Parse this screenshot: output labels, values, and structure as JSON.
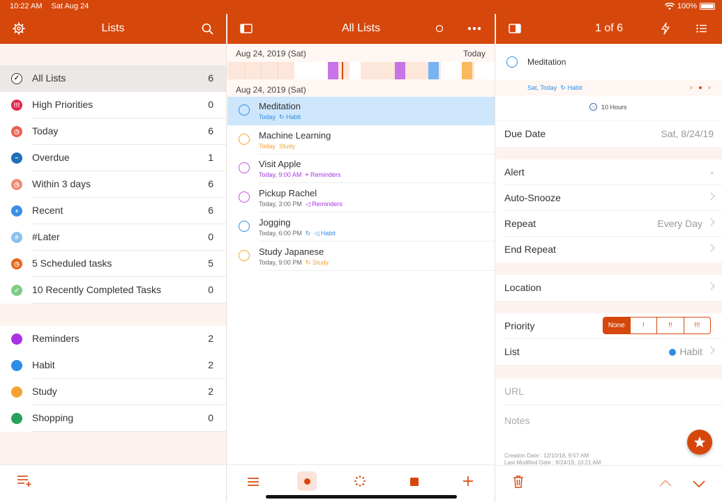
{
  "status": {
    "time": "10:22 AM",
    "date": "Sat Aug 24",
    "battery": "100%"
  },
  "colors": {
    "accent": "#d6470c",
    "habit": "#2d8ee6",
    "study": "#f4a332",
    "reminders": "#a933e0",
    "shopping": "#27a05d"
  },
  "left": {
    "title": "Lists",
    "smart_lists": [
      {
        "label": "All Lists",
        "count": "6",
        "icon": "check-circle-icon"
      },
      {
        "label": "High Priorities",
        "count": "0",
        "icon": "priority-icon"
      },
      {
        "label": "Today",
        "count": "6",
        "icon": "clock-icon"
      },
      {
        "label": "Overdue",
        "count": "1",
        "icon": "overdue-icon"
      },
      {
        "label": "Within 3 days",
        "count": "6",
        "icon": "clock-icon"
      },
      {
        "label": "Recent",
        "count": "6",
        "icon": "plus-icon"
      },
      {
        "label": "#Later",
        "count": "0",
        "icon": "hash-icon"
      },
      {
        "label": "5 Scheduled tasks",
        "count": "5",
        "icon": "clock-icon"
      },
      {
        "label": "10 Recently Completed Tasks",
        "count": "0",
        "icon": "check-icon"
      }
    ],
    "user_lists": [
      {
        "label": "Reminders",
        "count": "2"
      },
      {
        "label": "Habit",
        "count": "2"
      },
      {
        "label": "Study",
        "count": "2"
      },
      {
        "label": "Shopping",
        "count": "0"
      }
    ]
  },
  "middle": {
    "title": "All Lists",
    "timeline_date": "Aug 24, 2019 (Sat)",
    "timeline_today": "Today",
    "section_date": "Aug 24, 2019 (Sat)",
    "tasks": [
      {
        "title": "Meditation",
        "when": "Today",
        "list": "Habit"
      },
      {
        "title": "Machine Learning",
        "when": "Today",
        "list": "Study"
      },
      {
        "title": "Visit Apple",
        "when": "Today, 9:00 AM",
        "list": "Reminders"
      },
      {
        "title": "Pickup Rachel",
        "when": "Today, 3:00 PM",
        "list": "Reminders"
      },
      {
        "title": "Jogging",
        "when": "Today, 6:00 PM",
        "list": "Habit"
      },
      {
        "title": "Study Japanese",
        "when": "Today, 9:00 PM",
        "list": "Study"
      }
    ]
  },
  "right": {
    "title": "1 of 6",
    "task_title": "Meditation",
    "task_when": "Sat, Today",
    "task_list": "Habit",
    "duration": "10 Hours",
    "due_label": "Due Date",
    "due_value": "Sat, 8/24/19",
    "alert_label": "Alert",
    "alert_value": "-",
    "snooze_label": "Auto-Snooze",
    "repeat_label": "Repeat",
    "repeat_value": "Every Day",
    "end_repeat_label": "End Repeat",
    "location_label": "Location",
    "priority_label": "Priority",
    "priority_options": [
      "None",
      "!",
      "!!",
      "!!!"
    ],
    "list_label": "List",
    "list_value": "Habit",
    "url_label": "URL",
    "notes_label": "Notes",
    "creation": "Creation Date : 12/10/18, 9:57 AM",
    "modified": "Last Modified Date : 8/24/19, 10:21 AM"
  }
}
